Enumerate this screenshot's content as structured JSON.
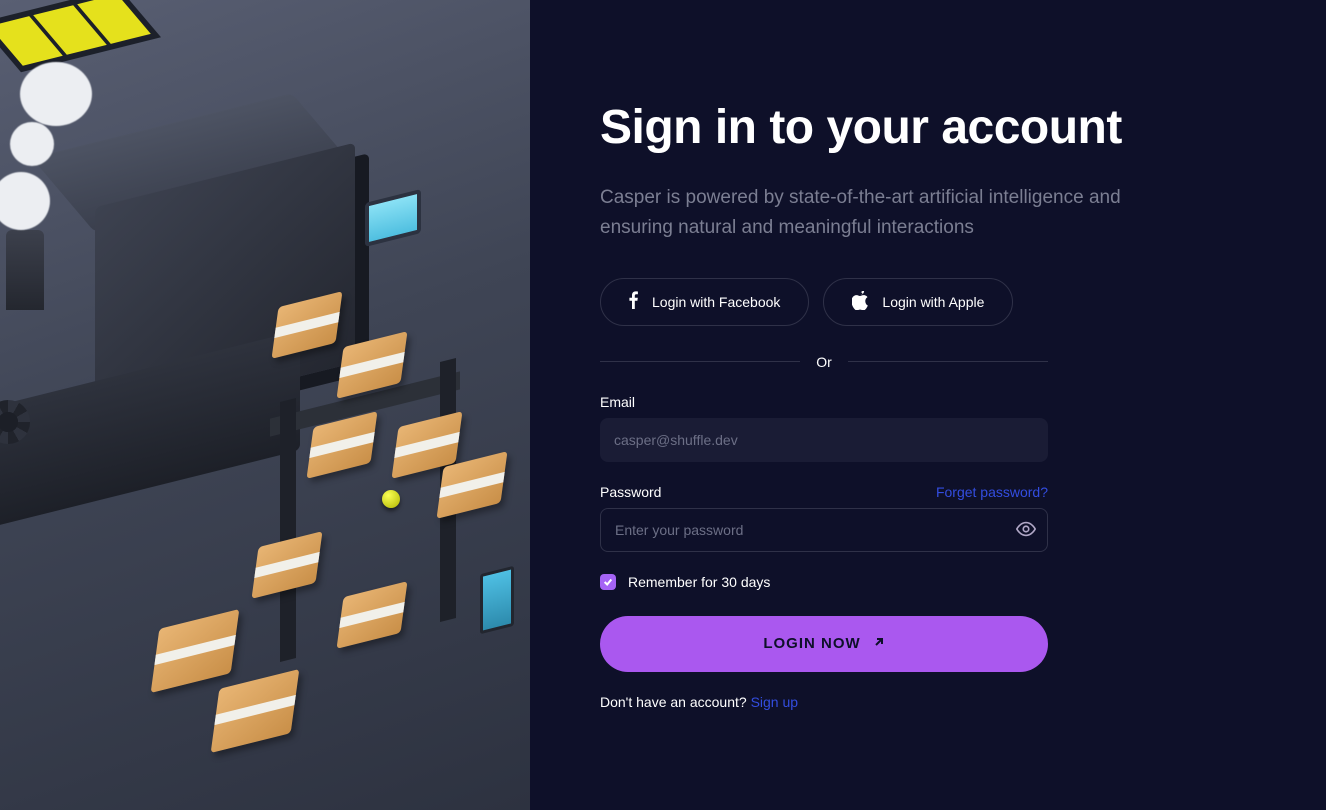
{
  "title": "Sign in to your account",
  "subtitle": "Casper is powered by state-of-the-art artificial intelligence and ensuring natural and meaningful interactions",
  "social": {
    "facebook": "Login with Facebook",
    "apple": "Login with Apple"
  },
  "divider": "Or",
  "fields": {
    "email": {
      "label": "Email",
      "placeholder": "casper@shuffle.dev",
      "value": ""
    },
    "password": {
      "label": "Password",
      "placeholder": "Enter your password",
      "value": ""
    }
  },
  "links": {
    "forgot": "Forget password?",
    "signup_prompt": "Don't have an account? ",
    "signup": "Sign up"
  },
  "remember": {
    "label": "Remember for 30 days",
    "checked": true
  },
  "cta": "LOGIN NOW",
  "colors": {
    "bg": "#0e1029",
    "accent": "#aa58ef",
    "link": "#334de0"
  }
}
